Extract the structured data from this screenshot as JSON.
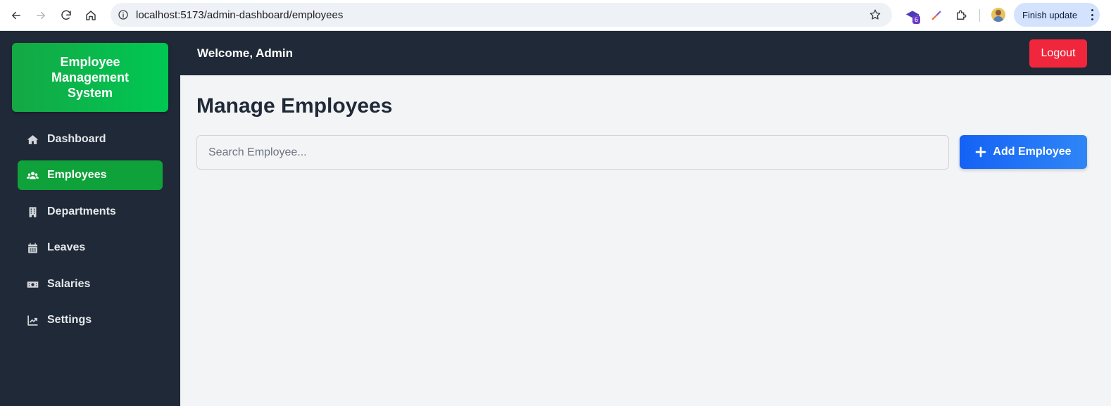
{
  "browser": {
    "url": "localhost:5173/admin-dashboard/employees",
    "extension_badge": "6",
    "finish_update_label": "Finish update"
  },
  "sidebar": {
    "brand": "Employee Management System",
    "items": [
      {
        "label": "Dashboard",
        "icon": "home-icon",
        "active": false
      },
      {
        "label": "Employees",
        "icon": "users-icon",
        "active": true
      },
      {
        "label": "Departments",
        "icon": "building-icon",
        "active": false
      },
      {
        "label": "Leaves",
        "icon": "calendar-icon",
        "active": false
      },
      {
        "label": "Salaries",
        "icon": "money-icon",
        "active": false
      },
      {
        "label": "Settings",
        "icon": "chart-line-icon",
        "active": false
      }
    ]
  },
  "header": {
    "welcome": "Welcome, Admin",
    "logout_label": "Logout"
  },
  "main": {
    "title": "Manage Employees",
    "search_placeholder": "Search Employee...",
    "search_value": "",
    "add_button_label": "Add Employee"
  },
  "colors": {
    "sidebar_bg": "#1f2937",
    "brand_green": "#00c853",
    "active_green": "#0fa23a",
    "logout_red": "#f0263c",
    "primary_blue": "#1462f5",
    "content_bg": "#f3f4f6"
  }
}
